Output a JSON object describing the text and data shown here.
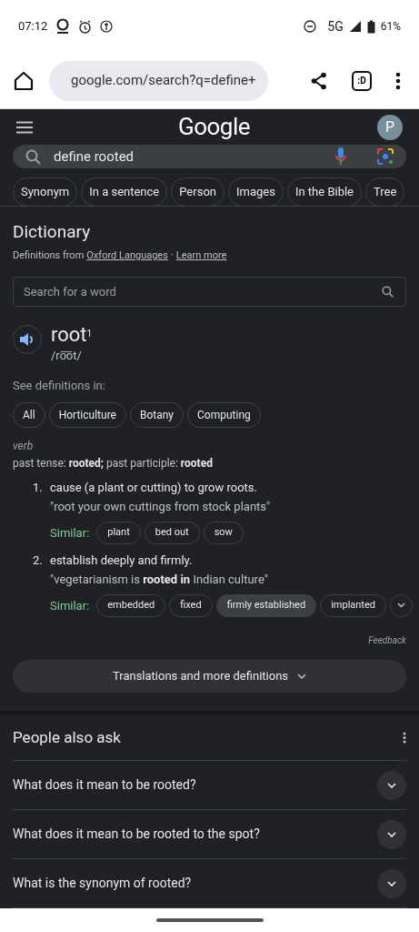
{
  "status_bar": {
    "time": "07:12",
    "network": "5G",
    "battery": "61%"
  },
  "browser": {
    "url": "google.com/search?q=define+",
    "tab_switcher": ":D"
  },
  "header": {
    "logo": "Google",
    "avatar": "P"
  },
  "search": {
    "value": "define rooted"
  },
  "chips": [
    "Synonym",
    "In a sentence",
    "Person",
    "Images",
    "In the Bible",
    "Tree"
  ],
  "dictionary": {
    "title": "Dictionary",
    "source_prefix": "Definitions from",
    "source_link": "Oxford Languages",
    "separator": "·",
    "learn_more": "Learn more",
    "word_search": {
      "placeholder": "Search for a word"
    },
    "headword": "root$^{1}$",
    "pronunciation": "/ro͞ot/",
    "see_in_label": "See definitions in:",
    "domains": [
      {
        "label": "All",
        "selected": false
      },
      {
        "label": "Horticulture",
        "selected": false
      },
      {
        "label": "Botany",
        "selected": false
      },
      {
        "label": "Computing",
        "selected": false
      }
    ],
    "part_of_speech": "verb",
    "forms": "past tense: **rooted;** past participle: **rooted**",
    "senses": [
      {
        "number": "1.",
        "definition": "cause (a plant or cutting) to grow roots.",
        "example": "\"root your own cuttings from stock plants\"",
        "similar_label": "Similar:",
        "similar": [
          {
            "label": "plant",
            "highlighted": false
          },
          {
            "label": "bed out",
            "highlighted": false
          },
          {
            "label": "sow",
            "highlighted": false
          }
        ],
        "more": false
      },
      {
        "number": "2.",
        "definition": "establish deeply and firmly.",
        "example": "\"vegetarianism is **rooted in** Indian culture\"",
        "similar_label": "Similar:",
        "similar": [
          {
            "label": "embedded",
            "highlighted": false
          },
          {
            "label": "fixed",
            "highlighted": false
          },
          {
            "label": "firmly established",
            "highlighted": true
          },
          {
            "label": "implanted",
            "highlighted": false
          }
        ],
        "more": true
      }
    ],
    "feedback": "Feedback",
    "more_button": "Translations and more definitions"
  },
  "people_also_ask": {
    "title": "People also ask",
    "questions": [
      {
        "text": "What does it mean to be rooted?",
        "expanded": false
      },
      {
        "text": "What does it mean to be rooted to the spot?",
        "expanded": false
      },
      {
        "text": "What is the synonym of rooted?",
        "expanded": false
      }
    ]
  }
}
